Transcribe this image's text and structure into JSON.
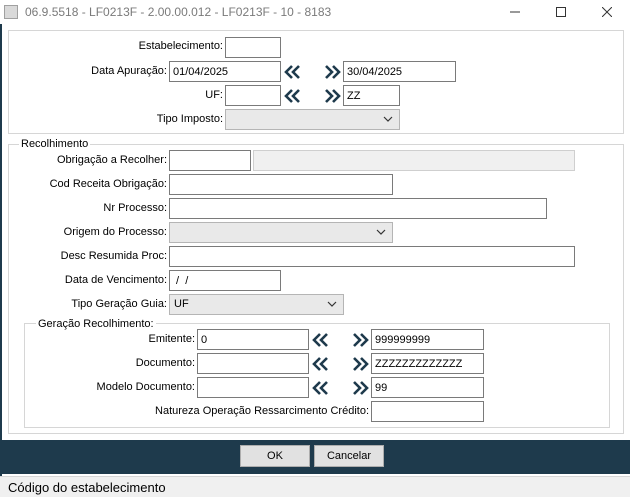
{
  "window": {
    "title": "06.9.5518 - LF0213F - 2.00.00.012 - LF0213F - 10 - 8183"
  },
  "header": {
    "estabelecimento": {
      "label": "Estabelecimento:",
      "value": ""
    },
    "data_apuracao": {
      "label": "Data Apuração:",
      "from": "01/04/2025",
      "to": "30/04/2025"
    },
    "uf": {
      "label": "UF:",
      "from": "",
      "to": "ZZ"
    },
    "tipo_imposto": {
      "label": "Tipo Imposto:",
      "value": ""
    }
  },
  "recolhimento": {
    "legend": "Recolhimento",
    "obrigacao": {
      "label": "Obrigação a Recolher:",
      "code": "",
      "description": ""
    },
    "cod_receita": {
      "label": "Cod Receita Obrigação:",
      "value": ""
    },
    "nr_processo": {
      "label": "Nr Processo:",
      "value": ""
    },
    "origem_processo": {
      "label": "Origem do Processo:",
      "value": ""
    },
    "desc_resumida": {
      "label": "Desc Resumida Proc:",
      "value": ""
    },
    "data_vencimento": {
      "label": "Data de Vencimento:",
      "value": " /  /"
    },
    "tipo_geracao": {
      "label": "Tipo Geração Guia:",
      "value": "UF"
    }
  },
  "geracao": {
    "legend": "Geração Recolhimento:",
    "emitente": {
      "label": "Emitente:",
      "from": "0",
      "to": "999999999"
    },
    "documento": {
      "label": "Documento:",
      "from": "",
      "to": "ZZZZZZZZZZZZZ"
    },
    "modelo": {
      "label": "Modelo Documento:",
      "from": "",
      "to": "99"
    },
    "natureza": {
      "label": "Natureza Operação Ressarcimento Crédito:",
      "value": ""
    }
  },
  "buttons": {
    "ok": "OK",
    "cancel": "Cancelar"
  },
  "status": {
    "text": "Código do estabelecimento"
  },
  "colors": {
    "footer": "#1e3a4c",
    "arrow": "#1e3a4c"
  }
}
